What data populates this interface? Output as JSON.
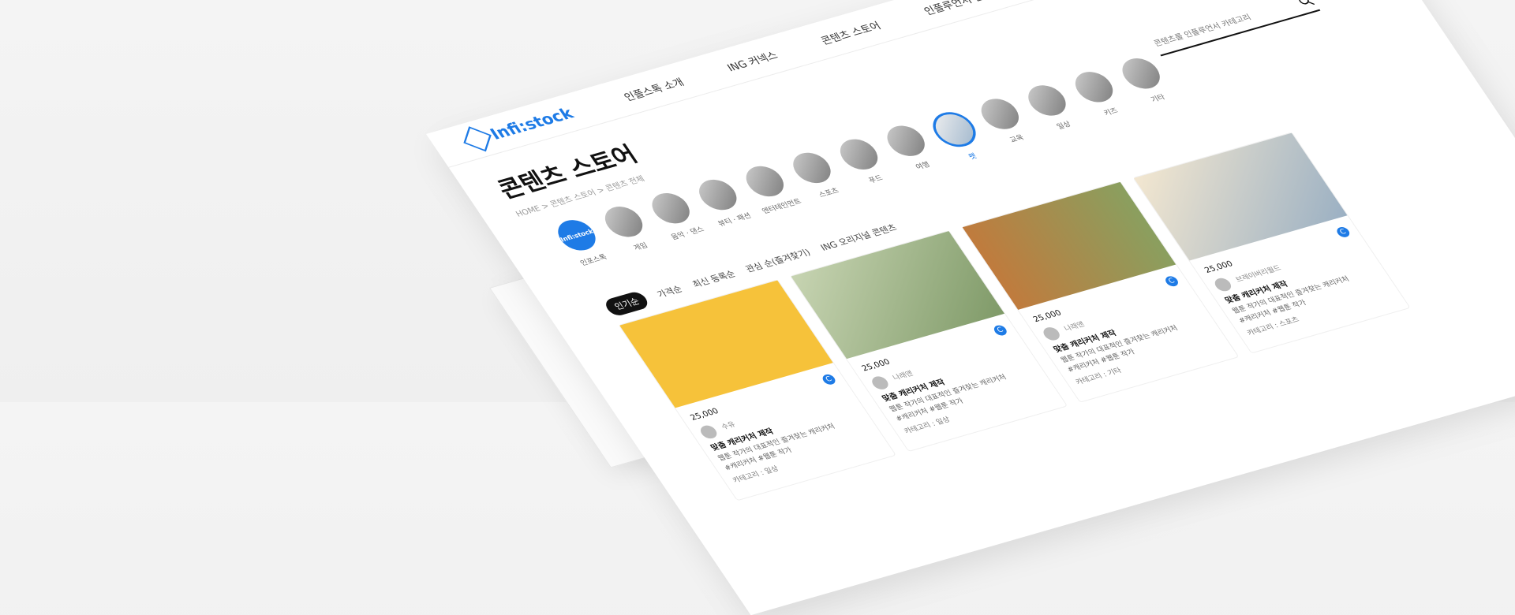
{
  "brand": {
    "logo_text": "Infi:stock"
  },
  "nav": {
    "items": [
      "인플스톡 소개",
      "ING 커넥스",
      "콘텐츠 스토어",
      "인플루언서 참여"
    ]
  },
  "header": {
    "title": "콘텐츠 스토어",
    "breadcrumb": "HOME > 콘텐츠 스토어 > 콘텐츠 전체"
  },
  "search": {
    "placeholder": "콘텐츠를 인플루언서 카테고리"
  },
  "categories": [
    {
      "label": "인포스톡",
      "type": "brand"
    },
    {
      "label": "게임",
      "type": "img"
    },
    {
      "label": "음악 · 댄스",
      "type": "img"
    },
    {
      "label": "뷰티 · 패션",
      "type": "img"
    },
    {
      "label": "엔터테인먼트",
      "type": "img"
    },
    {
      "label": "스포츠",
      "type": "img"
    },
    {
      "label": "푸드",
      "type": "img"
    },
    {
      "label": "여행",
      "type": "img"
    },
    {
      "label": "펫",
      "type": "selected"
    },
    {
      "label": "교육",
      "type": "img"
    },
    {
      "label": "일상",
      "type": "img"
    },
    {
      "label": "키즈",
      "type": "img"
    },
    {
      "label": "기타",
      "type": "img"
    }
  ],
  "filters": {
    "active": "인기순",
    "items": [
      "가격순",
      "최신 등록순",
      "관심 순(즐겨찾기)",
      "ING 오리지널 콘텐츠"
    ]
  },
  "cards": [
    {
      "thumb": "yellow",
      "price": "25,000",
      "author": "수유",
      "title": "맞춤 캐리커처 제작",
      "desc": "웹툰 작가의 대표적인 즐겨찾는 캐리커처",
      "tags": "#캐리커처 #웹툰 작가",
      "category": "카테고리 : 일상"
    },
    {
      "thumb": "green",
      "price": "25,000",
      "author": "나래앤",
      "title": "맞춤 캐리커처 제작",
      "desc": "웹툰 작가의 대표적인 즐겨찾는 캐리커처",
      "tags": "#캐리커처 #웹툰 작가",
      "category": "카테고리 : 일상"
    },
    {
      "thumb": "food",
      "price": "25,000",
      "author": "나래앤",
      "title": "맞춤 캐리커처 제작",
      "desc": "웹툰 작가의 대표적인 즐겨찾는 캐리커처",
      "tags": "#캐리커처 #웹툰 작가",
      "category": "카테고리 : 기타"
    },
    {
      "thumb": "toys",
      "price": "25,000",
      "author": "브레이버리월드",
      "title": "맞춤 캐리커처 제작",
      "desc": "웹툰 작가의 대표적인 즐겨찾는 캐리커처",
      "tags": "#캐리커처 #웹툰 작가",
      "category": "카테고리 : 스포츠"
    }
  ],
  "icons": {
    "search": "search-icon",
    "coin": "coin-icon",
    "logo": "cube-logo-icon"
  },
  "colors": {
    "accent": "#1e7be6",
    "pill": "#111111"
  }
}
